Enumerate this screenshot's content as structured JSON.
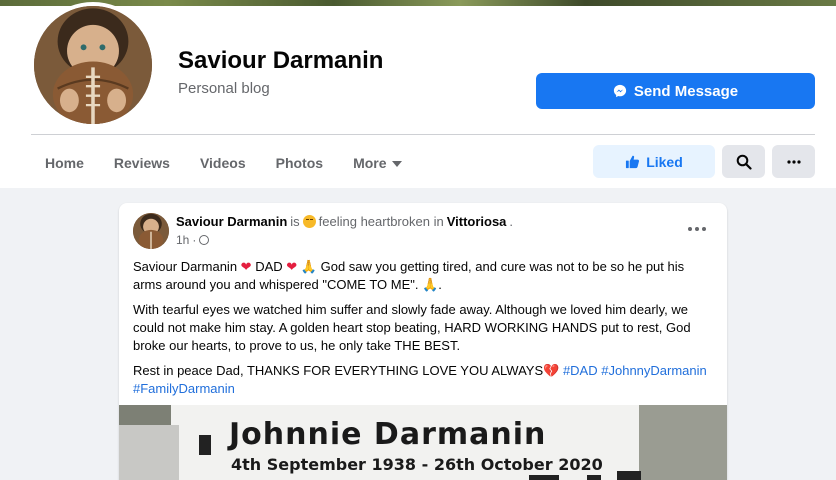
{
  "profile": {
    "name": "Saviour Darmanin",
    "category": "Personal blog",
    "send_message_label": "Send Message"
  },
  "nav": {
    "items": [
      "Home",
      "Reviews",
      "Videos",
      "Photos",
      "More"
    ],
    "liked_label": "Liked"
  },
  "post": {
    "author": "Saviour Darmanin",
    "is_text": "is",
    "feeling_text": "feeling heartbroken in",
    "place": "Vittoriosa",
    "time": "1h",
    "p1_a": "Saviour Darmanin",
    "p1_b": "DAD",
    "p1_c": "God saw you getting tired, and cure was not to be so he put his arms around you and whispered \"COME TO ME\".",
    "p2": "With tearful eyes we watched him suffer and slowly fade away. Although we loved him dearly, we could not make him stay. A golden heart stop beating, HARD WORKING HANDS put to rest, God broke our hearts, to prove to us, he only take THE BEST.",
    "p3": "Rest in peace Dad, THANKS FOR EVERYTHING LOVE YOU ALWAYS",
    "hashtags": [
      "#DAD",
      "#JohnnyDarmanin",
      "#FamilyDarmanin"
    ]
  },
  "memorial": {
    "name": "Johnnie Darmanin",
    "dates": "4th September 1938 - 26th October 2020"
  },
  "colors": {
    "brand": "#1877f2",
    "liked_bg": "#e7f3ff",
    "heart": "#e41e3f",
    "hashtag": "#216fdb"
  }
}
